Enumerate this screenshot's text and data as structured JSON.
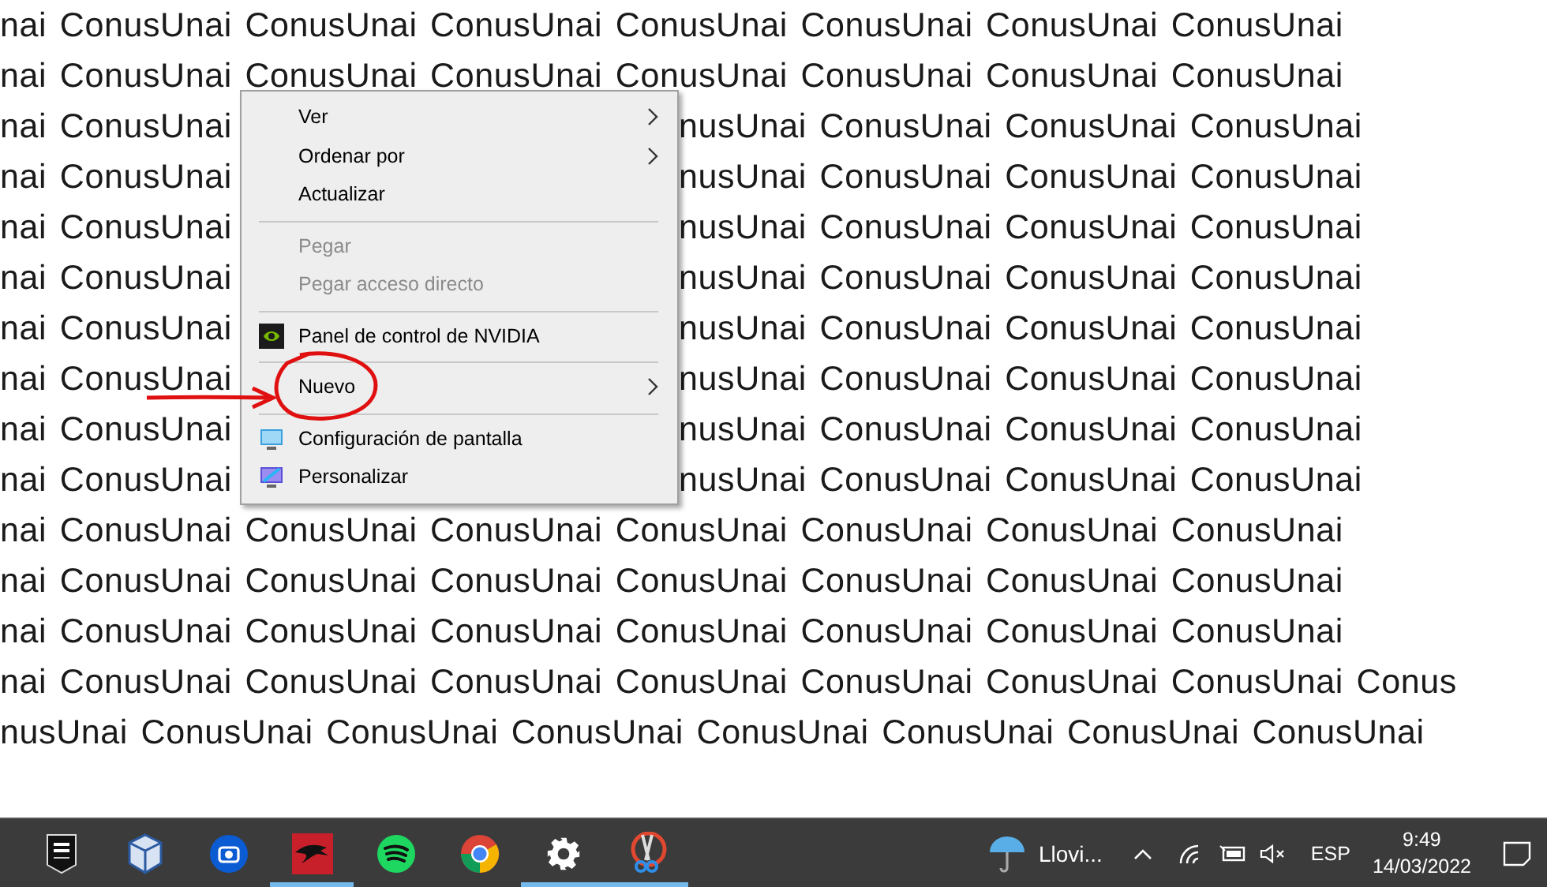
{
  "desktop": {
    "rows": [
      {
        "kind": "full",
        "text": "nai ConusUnai ConusUnai ConusUnai ConusUnai ConusUnai ConusUnai ConusUnai"
      },
      {
        "kind": "full",
        "text": "nai ConusUnai ConusUnai ConusUnai ConusUnai ConusUnai ConusUnai ConusUnai"
      },
      {
        "kind": "split",
        "left": "nai ConusUnai",
        "right": "nusUnai ConusUnai ConusUnai ConusUnai"
      },
      {
        "kind": "split",
        "left": "nai ConusUnai",
        "right": "nusUnai ConusUnai ConusUnai ConusUnai"
      },
      {
        "kind": "split",
        "left": "nai ConusUnai",
        "right": "nusUnai ConusUnai ConusUnai ConusUnai"
      },
      {
        "kind": "split",
        "left": "nai ConusUnai",
        "right": "nusUnai ConusUnai ConusUnai ConusUnai"
      },
      {
        "kind": "split",
        "left": "nai ConusUnai",
        "right": "nusUnai ConusUnai ConusUnai ConusUnai"
      },
      {
        "kind": "split",
        "left": "nai ConusUnai",
        "right": "nusUnai ConusUnai ConusUnai ConusUnai"
      },
      {
        "kind": "split",
        "left": "nai ConusUnai",
        "right": "nusUnai ConusUnai ConusUnai ConusUnai"
      },
      {
        "kind": "split",
        "left": "nai ConusUnai",
        "right": "nusUnai ConusUnai ConusUnai ConusUnai"
      },
      {
        "kind": "full",
        "text": "nai ConusUnai ConusUnai ConusUnai ConusUnai ConusUnai ConusUnai ConusUnai"
      },
      {
        "kind": "full",
        "text": "nai ConusUnai ConusUnai ConusUnai ConusUnai ConusUnai ConusUnai ConusUnai"
      },
      {
        "kind": "full",
        "text": "nai ConusUnai ConusUnai ConusUnai ConusUnai ConusUnai ConusUnai ConusUnai"
      },
      {
        "kind": "full",
        "text": "nai ConusUnai ConusUnai ConusUnai ConusUnai ConusUnai ConusUnai ConusUnai Conus"
      },
      {
        "kind": "full",
        "text": "nusUnai ConusUnai ConusUnai ConusUnai ConusUnai ConusUnai ConusUnai ConusUnai"
      }
    ]
  },
  "context_menu": {
    "items": [
      {
        "kind": "item",
        "label": "Ver",
        "disabled": false,
        "submenu": true
      },
      {
        "kind": "item",
        "label": "Ordenar por",
        "disabled": false,
        "submenu": true
      },
      {
        "kind": "item",
        "label": "Actualizar",
        "disabled": false,
        "submenu": false
      },
      {
        "kind": "separator"
      },
      {
        "kind": "item",
        "label": "Pegar",
        "disabled": true,
        "submenu": false
      },
      {
        "kind": "item",
        "label": "Pegar acceso directo",
        "disabled": true,
        "submenu": false
      },
      {
        "kind": "separator"
      },
      {
        "kind": "item",
        "label": "Panel de control de NVIDIA",
        "disabled": false,
        "submenu": false
      },
      {
        "kind": "separator"
      },
      {
        "kind": "item",
        "label": "Nuevo",
        "disabled": false,
        "submenu": true
      },
      {
        "kind": "separator"
      },
      {
        "kind": "item",
        "label": "Configuración de pantalla",
        "disabled": false,
        "submenu": false
      },
      {
        "kind": "item",
        "label": "Personalizar",
        "disabled": false,
        "submenu": false
      }
    ]
  },
  "taskbar": {
    "apps": [
      {
        "running": false
      },
      {
        "running": false
      },
      {
        "running": false
      },
      {
        "running": true
      },
      {
        "running": false
      },
      {
        "running": false
      },
      {
        "running": true
      },
      {
        "running": true
      }
    ],
    "weather": "Llovi...",
    "language": "ESP",
    "time": "9:49",
    "date": "14/03/2022"
  }
}
